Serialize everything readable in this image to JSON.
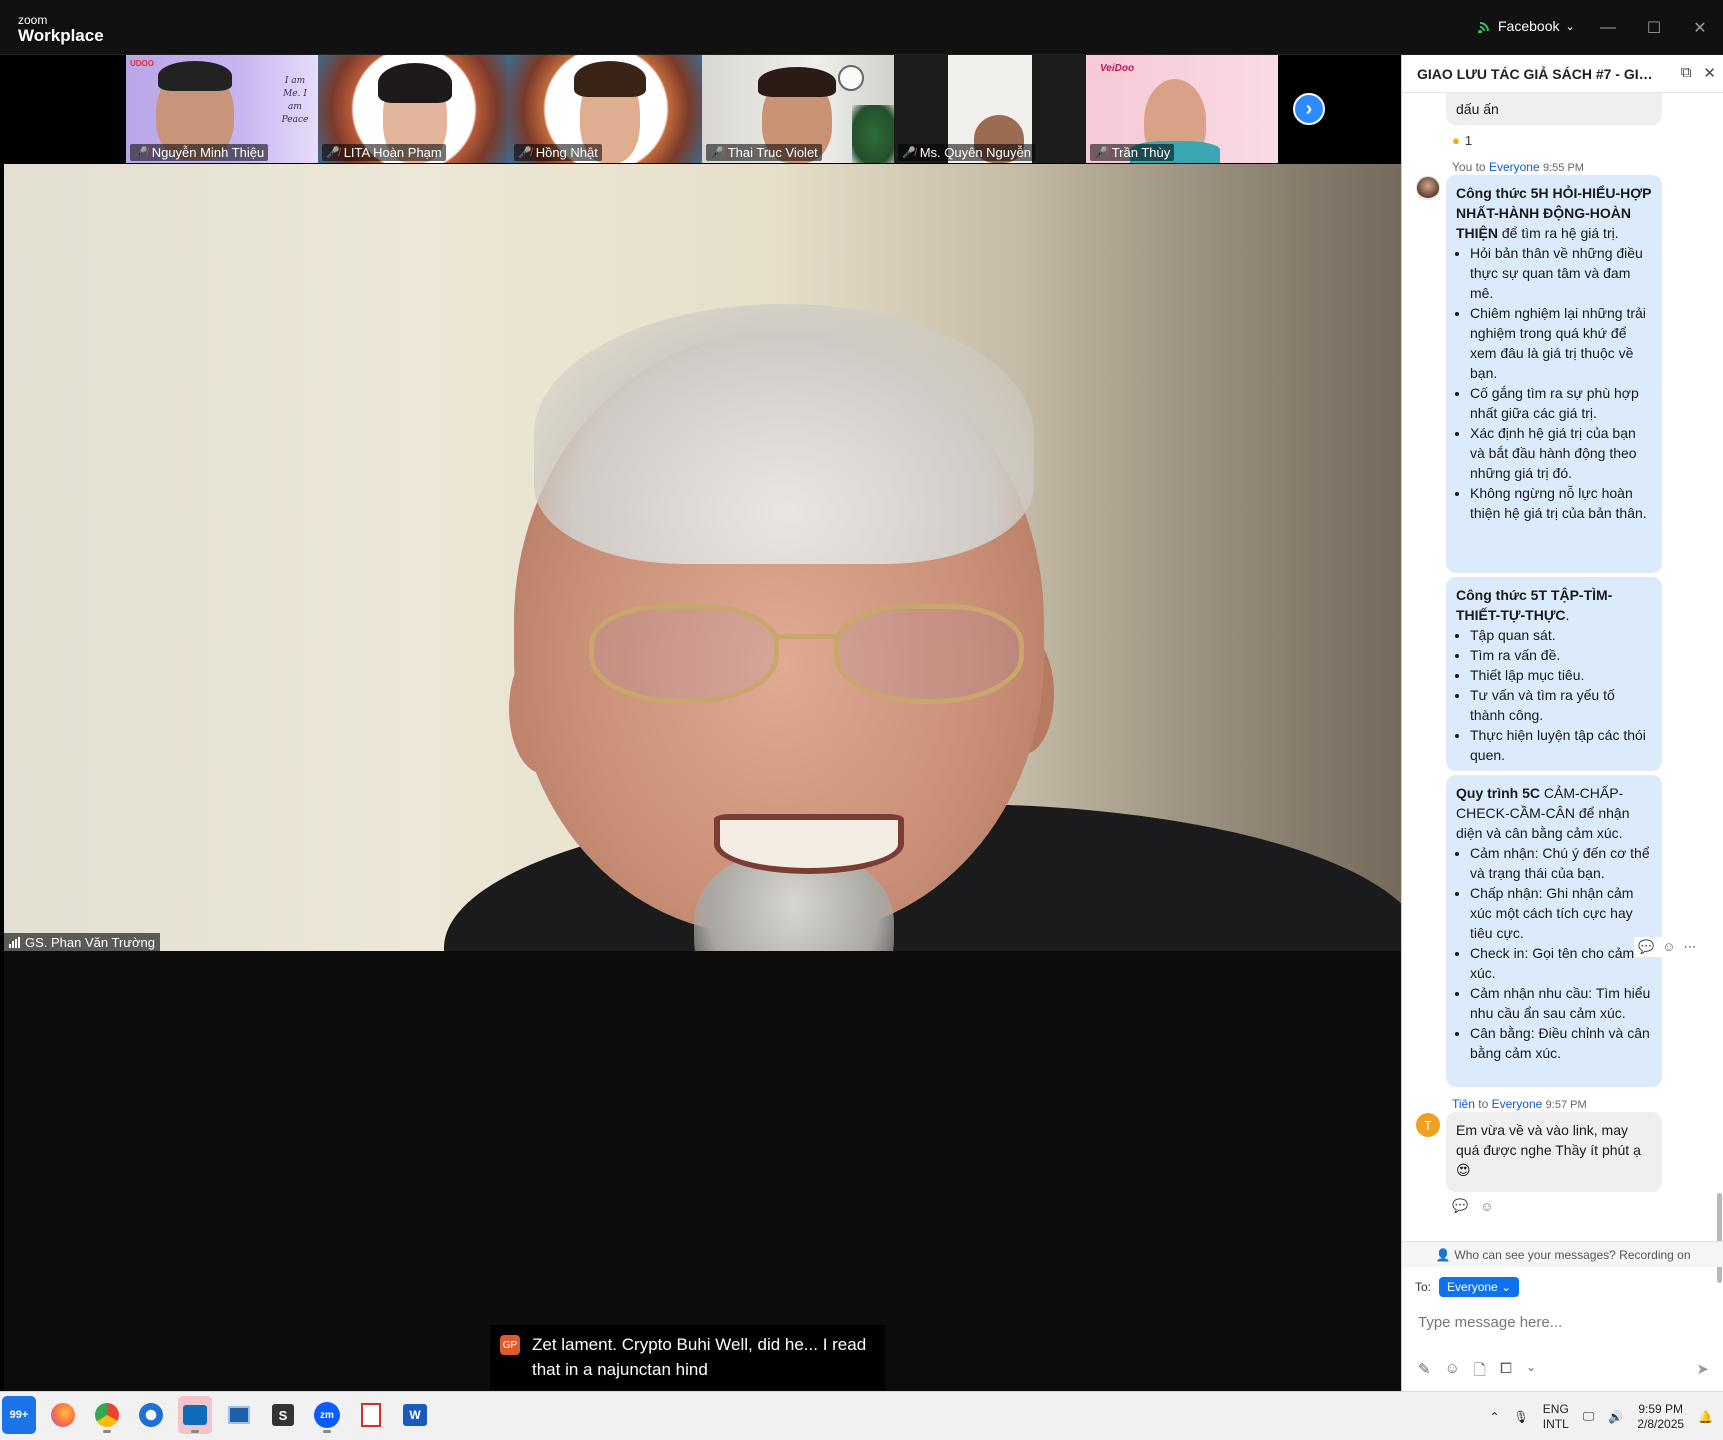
{
  "window": {
    "brand_small": "zoom",
    "brand_big": "Workplace",
    "share_source": "Facebook",
    "controls": [
      "—",
      "☐",
      "✕"
    ]
  },
  "participants": [
    {
      "name": "Nguyễn Minh Thiệu",
      "muted": true
    },
    {
      "name": "LITA Hoàn Phạm",
      "muted": true
    },
    {
      "name": "Hồng Nhật",
      "muted": true
    },
    {
      "name": "Thai Truc Violet",
      "muted": true
    },
    {
      "name": "Ms. Quyên Nguyễn",
      "muted": true
    },
    {
      "name": "Trần Thùy",
      "muted": true
    }
  ],
  "thumb_overlay_text": {
    "udoo_logo": "UDOO",
    "peace_text": "I am Me. I am Peace",
    "veidoo_logo": "VeiDoo"
  },
  "speaker": {
    "name": "GS. Phan Văn Trường"
  },
  "caption": {
    "initials": "GP",
    "text": "Zet lament. Crypto Buhi Well, did he... I read that in a najunctan hind"
  },
  "chat": {
    "title": "GIAO LƯU TÁC GIẢ SÁCH #7 - GIẢI M...",
    "prev_message_tail": "dấu ấn",
    "prev_reaction_count": "1",
    "msg1": {
      "sender": "You",
      "to_word": "to",
      "recipient": "Everyone",
      "time": "9:55 PM",
      "block1_bold": "Công thức 5H HỎI-HIỂU-HỢP NHẤT-HÀNH ĐỘNG-HOÀN THIỆN",
      "block1_rest": " để tìm ra hệ giá trị.",
      "block1_items": [
        "Hỏi bản thân về những điều thực sự quan tâm và đam mê.",
        "Chiêm nghiệm lại những trải nghiệm trong quá khứ để xem đâu là giá trị thuộc về bạn.",
        "Cố gắng tìm ra sự phù hợp nhất giữa các giá trị.",
        "Xác định hệ giá trị của bạn và bắt đầu hành động theo những giá trị đó.",
        "Không ngừng nỗ lực hoàn thiện hệ giá trị của bản thân."
      ],
      "block2_bold": "Công thức 5T TẬP-TÌM-THIẾT-TỰ-THỰC",
      "block2_rest": ".",
      "block2_items": [
        "Tập quan sát.",
        "Tìm ra vấn đề.",
        "Thiết lập mục tiêu.",
        "Tư vấn và tìm ra yếu tố thành công.",
        "Thực hiện luyện tập các thói quen."
      ],
      "block3_bold": "Quy trình 5C",
      "block3_rest": " CẢM-CHẤP-CHECK-CẦM-CÂN để nhận diện và cân bằng cảm xúc.",
      "block3_items": [
        "Cảm nhận: Chú ý đến cơ thể và trạng thái của bạn.",
        "Chấp nhận: Ghi nhận cảm xúc một cách tích cực hay tiêu cực.",
        "Check in: Gọi tên cho cảm xúc.",
        "Cảm nhận nhu cầu: Tìm hiểu nhu cầu ẩn sau cảm xúc.",
        "Cân bằng: Điều chỉnh và cân bằng cảm xúc."
      ]
    },
    "msg2": {
      "sender": "Tiên",
      "initial": "T",
      "to_word": "to",
      "recipient": "Everyone",
      "time": "9:57 PM",
      "text": "Em vừa về và vào link, may quá được nghe Thầy ít phút ạ 😍"
    },
    "notice": "Who can see your messages? Recording on",
    "to_label": "To:",
    "to_value": "Everyone",
    "input_placeholder": "Type message here..."
  },
  "taskbar": {
    "badge": "99+",
    "apps": [
      "mail",
      "firefox",
      "chrome",
      "thunderbird",
      "outlook",
      "window",
      "s-app",
      "zoom",
      "acrobat",
      "word"
    ],
    "lang_top": "ENG",
    "lang_bottom": "INTL",
    "time": "9:59 PM",
    "date": "2/8/2025"
  },
  "colors": {
    "accent": "#0e72ed",
    "bubble_self": "#dcebfb",
    "bubble_other": "#efefef",
    "muted_red": "#e34b4b",
    "next_button": "#2d8cff"
  }
}
